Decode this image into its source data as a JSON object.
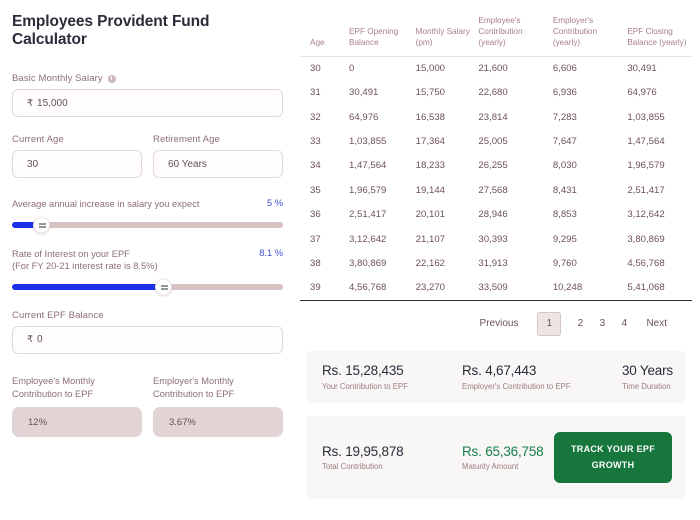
{
  "page_title": "Employees Provident Fund Calculator",
  "colors": {
    "accent_blue": "#1a31e8",
    "value_blue": "#3c4fd0",
    "label_mauve": "#8d6f73",
    "green": "#16763c",
    "maturity_green": "#16804a",
    "track_grey": "#d5c2c2"
  },
  "form": {
    "basic_salary": {
      "label": "Basic Monthly Salary",
      "info_icon": "info-icon",
      "currency": "₹",
      "value": "15,000"
    },
    "current_age": {
      "label": "Current Age",
      "value": "30"
    },
    "retirement_age": {
      "label": "Retirement Age",
      "value": "60 Years"
    },
    "salary_increase": {
      "label": "Average annual increase in salary you expect",
      "value": "5 %",
      "fill_percent": 11
    },
    "interest_rate": {
      "label_line1": "Rate of Interest on your EPF",
      "label_line2": "(For FY 20-21 interest rate is 8.5%)",
      "value": "8.1 %",
      "fill_percent": 56
    },
    "current_balance": {
      "label": "Current EPF Balance",
      "currency": "₹",
      "value": "0"
    },
    "employee_contribution": {
      "label_line1": "Employee's Monthly",
      "label_line2": "Contribution to EPF",
      "value": "12%"
    },
    "employer_contribution": {
      "label_line1": "Employer's Monthly",
      "label_line2": "Contribution to EPF",
      "value": "3.67%"
    }
  },
  "table": {
    "headers": [
      "Age",
      "EPF Opening Balance",
      "Monthly Salary (pm)",
      "Employee's Contribution (yearly)",
      "Employer's Contribution (yearly)",
      "EPF Closing Balance (yearly)"
    ],
    "rows": [
      [
        "30",
        "0",
        "15,000",
        "21,600",
        "6,606",
        "30,491"
      ],
      [
        "31",
        "30,491",
        "15,750",
        "22,680",
        "6,936",
        "64,976"
      ],
      [
        "32",
        "64,976",
        "16,538",
        "23,814",
        "7,283",
        "1,03,855"
      ],
      [
        "33",
        "1,03,855",
        "17,364",
        "25,005",
        "7,647",
        "1,47,564"
      ],
      [
        "34",
        "1,47,564",
        "18,233",
        "26,255",
        "8,030",
        "1,96,579"
      ],
      [
        "35",
        "1,96,579",
        "19,144",
        "27,568",
        "8,431",
        "2,51,417"
      ],
      [
        "36",
        "2,51,417",
        "20,101",
        "28,946",
        "8,853",
        "3,12,642"
      ],
      [
        "37",
        "3,12,642",
        "21,107",
        "30,393",
        "9,295",
        "3,80,869"
      ],
      [
        "38",
        "3,80,869",
        "22,162",
        "31,913",
        "9,760",
        "4,56,768"
      ],
      [
        "39",
        "4,56,768",
        "23,270",
        "33,509",
        "10,248",
        "5,41,068"
      ]
    ]
  },
  "pagination": {
    "previous": "Previous",
    "pages": [
      "1",
      "2",
      "3",
      "4"
    ],
    "active": "1",
    "next": "Next"
  },
  "summary_top": [
    {
      "value": "Rs. 15,28,435",
      "label": "Your Contribution to EPF"
    },
    {
      "value": "Rs. 4,67,443",
      "label": "Employer's Contribution to EPF"
    },
    {
      "value": "30 Years",
      "label": "Time Duration"
    }
  ],
  "summary_bottom": [
    {
      "value": "Rs. 19,95,878",
      "label": "Total Contribution"
    },
    {
      "value": "Rs. 65,36,758",
      "label": "Maturity Amount"
    }
  ],
  "cta": {
    "line1": "TRACK YOUR EPF",
    "line2": "GROWTH"
  }
}
